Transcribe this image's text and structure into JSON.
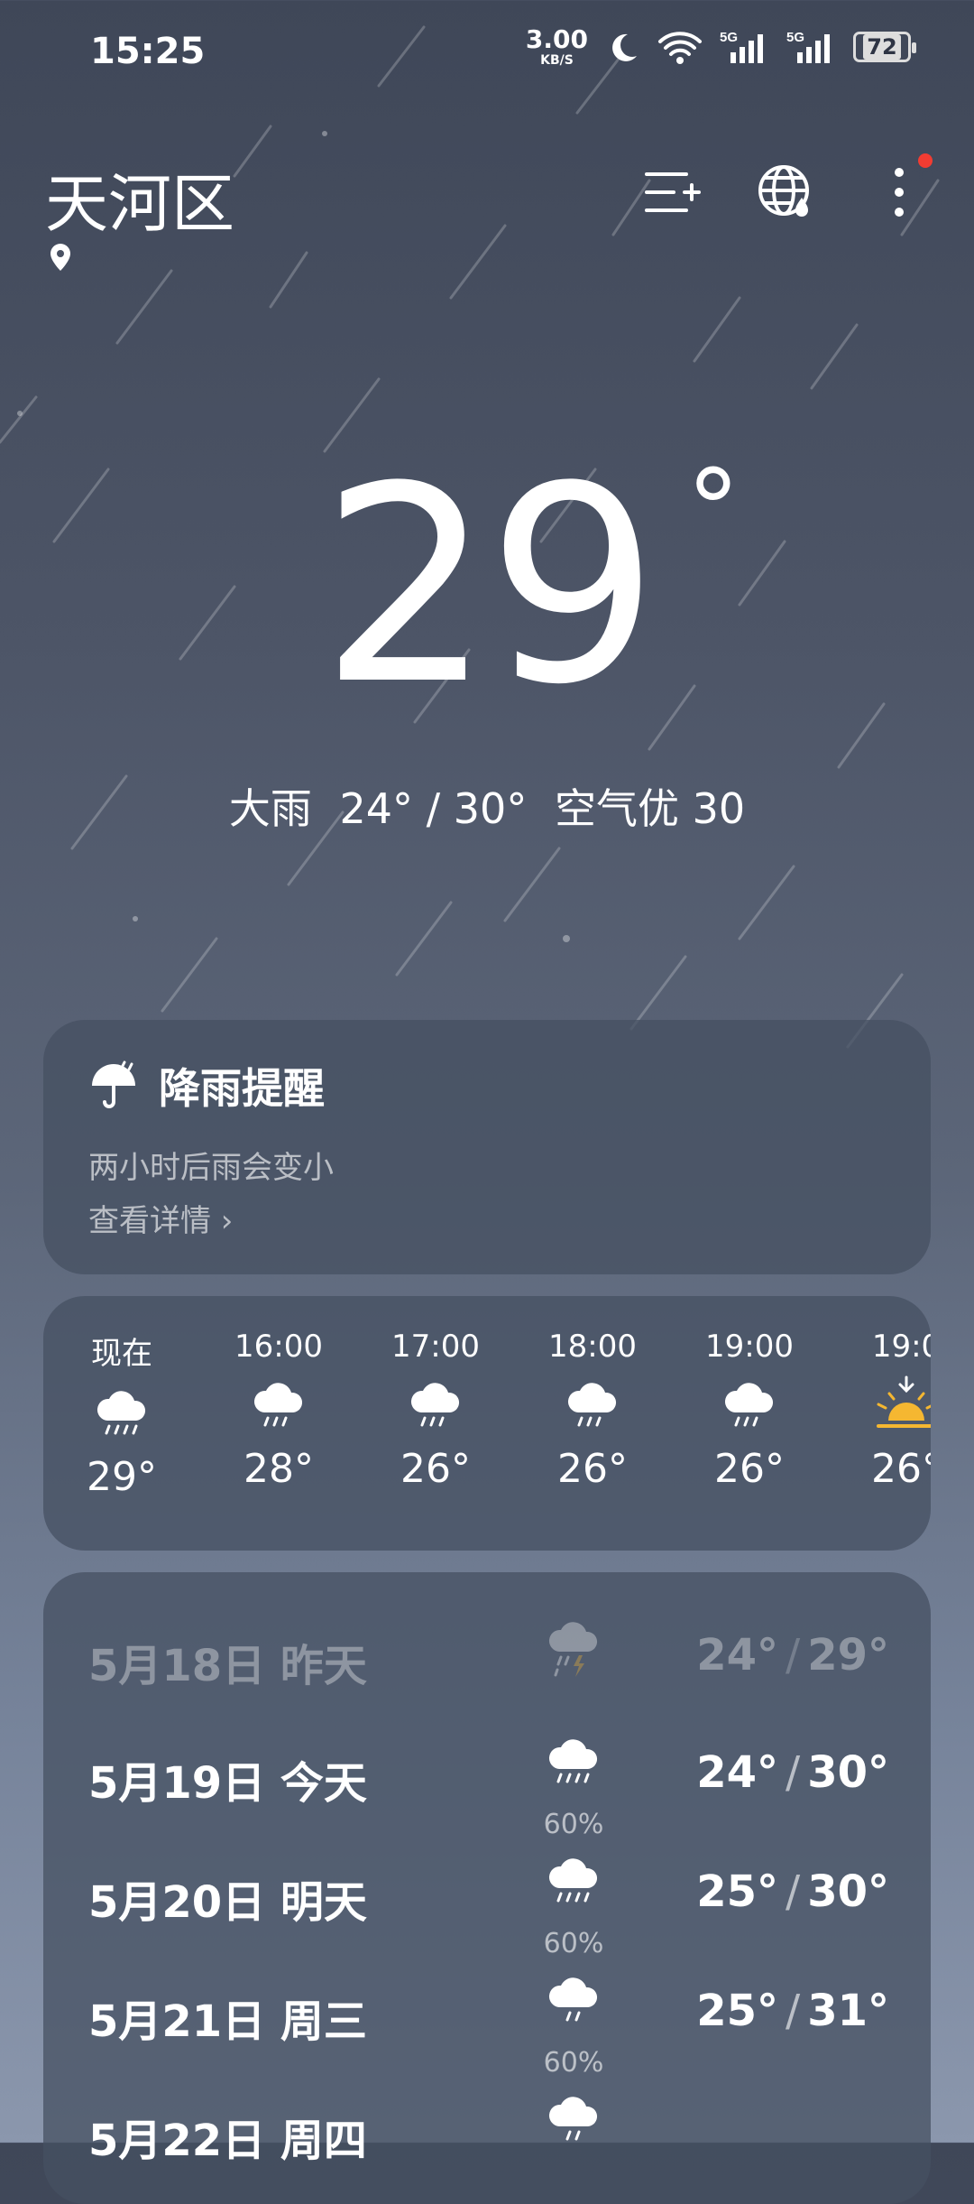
{
  "status_bar": {
    "time": "15:25",
    "net_speed": "3.00",
    "net_unit": "KB/S",
    "signal1": "5G",
    "signal2": "5G",
    "battery": "72"
  },
  "header": {
    "city": "天河区"
  },
  "current": {
    "temp": "29",
    "degree_symbol": "°",
    "condition": "大雨",
    "range": "24° / 30°",
    "air": "空气优 30"
  },
  "rain_alert": {
    "title": "降雨提醒",
    "description": "两小时后雨会变小",
    "link": "查看详情 ›"
  },
  "hourly": [
    {
      "time": "现在",
      "icon": "rain-cloud-icon",
      "temp": "29°"
    },
    {
      "time": "16:00",
      "icon": "rain-cloud-icon",
      "temp": "28°"
    },
    {
      "time": "17:00",
      "icon": "rain-cloud-icon",
      "temp": "26°"
    },
    {
      "time": "18:00",
      "icon": "rain-cloud-icon",
      "temp": "26°"
    },
    {
      "time": "19:00",
      "icon": "rain-cloud-icon",
      "temp": "26°"
    },
    {
      "time": "19:0",
      "icon": "sunset-icon",
      "temp": "26°"
    }
  ],
  "daily": [
    {
      "date": "5月18日  昨天",
      "icon": "thunder-rain-icon",
      "precip": "",
      "low": "24°",
      "high": "29°"
    },
    {
      "date": "5月19日  今天",
      "icon": "rain-cloud-icon",
      "precip": "60%",
      "low": "24°",
      "high": "30°"
    },
    {
      "date": "5月20日  明天",
      "icon": "rain-cloud-icon",
      "precip": "60%",
      "low": "25°",
      "high": "30°"
    },
    {
      "date": "5月21日  周三",
      "icon": "light-rain-icon",
      "precip": "60%",
      "low": "25°",
      "high": "31°"
    },
    {
      "date": "5月22日  周四",
      "icon": "light-rain-icon",
      "precip": "",
      "low": "",
      "high": ""
    }
  ],
  "colors": {
    "background_top": "#3f4758",
    "background_bottom": "#8b97ad",
    "card": "#465062",
    "notification_dot": "#f23c32",
    "sun": "#f5b731"
  }
}
